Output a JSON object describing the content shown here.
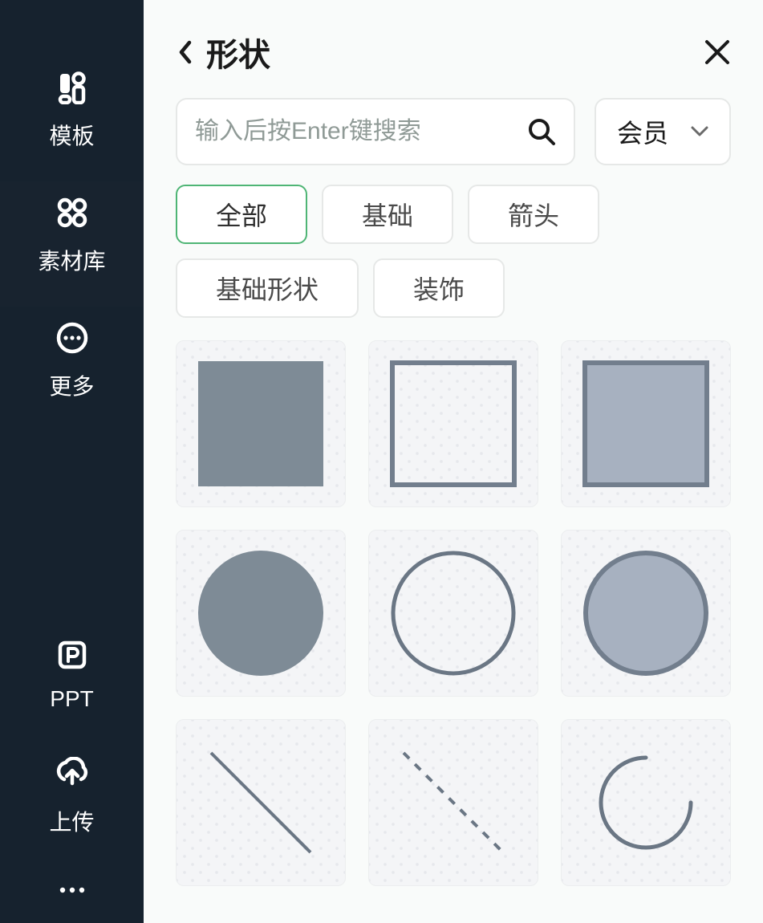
{
  "sidebar": {
    "items": [
      {
        "key": "templates",
        "label": "模板",
        "icon": "templates-icon"
      },
      {
        "key": "assets",
        "label": "素材库",
        "icon": "assets-icon"
      },
      {
        "key": "more",
        "label": "更多",
        "icon": "more-circle-icon"
      },
      {
        "key": "ppt",
        "label": "PPT",
        "icon": "ppt-icon"
      },
      {
        "key": "upload",
        "label": "上传",
        "icon": "upload-icon"
      }
    ]
  },
  "panel": {
    "title": "形状",
    "search": {
      "placeholder": "输入后按Enter键搜索"
    },
    "dropdown": {
      "label": "会员"
    },
    "filters": [
      {
        "key": "all",
        "label": "全部",
        "active": true
      },
      {
        "key": "basic",
        "label": "基础"
      },
      {
        "key": "arrow",
        "label": "箭头"
      },
      {
        "key": "basic-shape",
        "label": "基础形状"
      },
      {
        "key": "decor",
        "label": "装饰"
      }
    ],
    "shapes": [
      {
        "id": "square-filled",
        "name": "square-filled"
      },
      {
        "id": "square-outline",
        "name": "square-outline"
      },
      {
        "id": "square-filled-stroke",
        "name": "square-filled-stroke"
      },
      {
        "id": "circle-filled",
        "name": "circle-filled"
      },
      {
        "id": "circle-outline",
        "name": "circle-outline"
      },
      {
        "id": "circle-filled-stroke",
        "name": "circle-filled-stroke"
      },
      {
        "id": "line-solid",
        "name": "line-solid"
      },
      {
        "id": "line-dashed",
        "name": "line-dashed"
      },
      {
        "id": "arc",
        "name": "arc"
      }
    ],
    "colors": {
      "shape_fill_dark": "#7e8b96",
      "shape_fill_light": "#a7b1c0",
      "shape_stroke": "#727e8d",
      "shape_stroke_dark": "#6a7684"
    }
  }
}
